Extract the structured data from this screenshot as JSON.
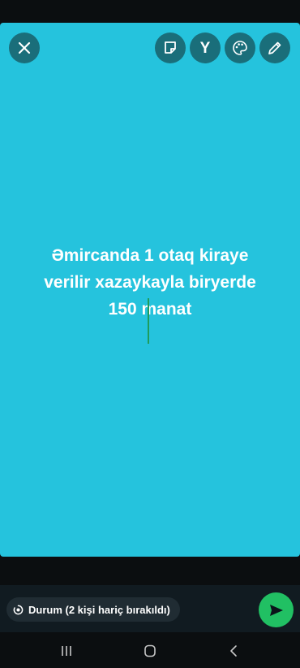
{
  "toolbar": {
    "close_icon": "close-icon",
    "sticker_icon": "sticker-icon",
    "text_icon": "text-style-icon",
    "text_glyph": "Y",
    "palette_icon": "palette-icon",
    "pencil_icon": "pencil-icon"
  },
  "status": {
    "background_color": "#25c3dd",
    "text_color": "#ffffff",
    "text": "Əmircanda 1 otaq kiraye\nverilir xazaykayla biryerde\n150 manat"
  },
  "audience": {
    "icon": "status-ring-icon",
    "label": "Durum (2 kişi hariç bırakıldı)"
  },
  "send": {
    "icon": "send-icon",
    "color": "#21c063"
  },
  "navigation": {
    "recents_icon": "recents-icon",
    "home_icon": "home-icon",
    "back_icon": "back-icon"
  }
}
